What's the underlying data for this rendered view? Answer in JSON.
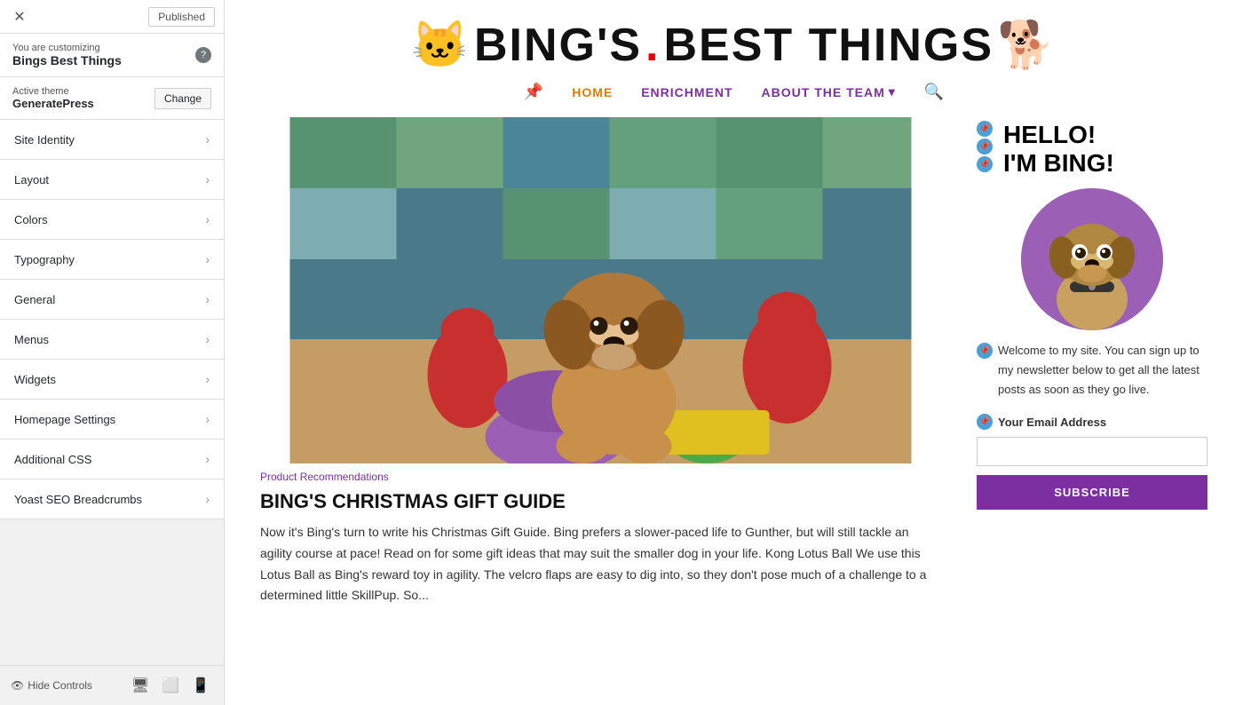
{
  "panel": {
    "close_label": "✕",
    "published_label": "Published",
    "customizing_label": "You are customizing",
    "site_name": "Bings Best Things",
    "help_label": "?",
    "theme_label": "Active theme",
    "theme_name": "GeneratePress",
    "change_label": "Change",
    "menu_items": [
      {
        "id": "site-identity",
        "label": "Site Identity"
      },
      {
        "id": "layout",
        "label": "Layout"
      },
      {
        "id": "colors",
        "label": "Colors"
      },
      {
        "id": "typography",
        "label": "Typography"
      },
      {
        "id": "general",
        "label": "General"
      },
      {
        "id": "menus",
        "label": "Menus"
      },
      {
        "id": "widgets",
        "label": "Widgets"
      },
      {
        "id": "homepage-settings",
        "label": "Homepage Settings"
      },
      {
        "id": "additional-css",
        "label": "Additional CSS"
      },
      {
        "id": "yoast-seo",
        "label": "Yoast SEO Breadcrumbs"
      }
    ],
    "hide_controls_label": "Hide Controls",
    "device_desktop": "🖥",
    "device_tablet": "📱",
    "device_mobile": "📱"
  },
  "site": {
    "logo_text_1": "BING'S",
    "logo_dot": ".",
    "logo_text_2": "BEST THINGS",
    "nav": {
      "icon": "📌",
      "home": "HOME",
      "enrichment": "ENRICHMENT",
      "about": "ABOUT THE TEAM",
      "search_icon": "🔍"
    }
  },
  "article": {
    "category": "Product Recommendations",
    "title": "BING'S CHRISTMAS GIFT GUIDE",
    "text": "Now it's Bing's turn to write his Christmas Gift Guide. Bing prefers a slower-paced life to Gunther, but will still tackle an agility course at pace!  Read on for some gift ideas that may suit the smaller dog in your life.  Kong Lotus Ball  We use this Lotus Ball as Bing's reward toy in agility. The velcro flaps are easy to dig into, so they don't pose much of a challenge to a determined little SkillPup. So..."
  },
  "sidebar": {
    "hello_line1": "HELLO!",
    "hello_line2": "I'M BING!",
    "welcome_text": "Welcome to my site. You can sign up to my newsletter below to get all the latest posts as soon as they go live.",
    "email_label": "Your Email Address",
    "email_placeholder": "",
    "subscribe_label": "SUBSCRIBE"
  },
  "colors": {
    "nav_active": "#e07b00",
    "nav_default": "#7b2fa0",
    "accent": "#7b2fa0",
    "pin": "#4a9fd4"
  }
}
